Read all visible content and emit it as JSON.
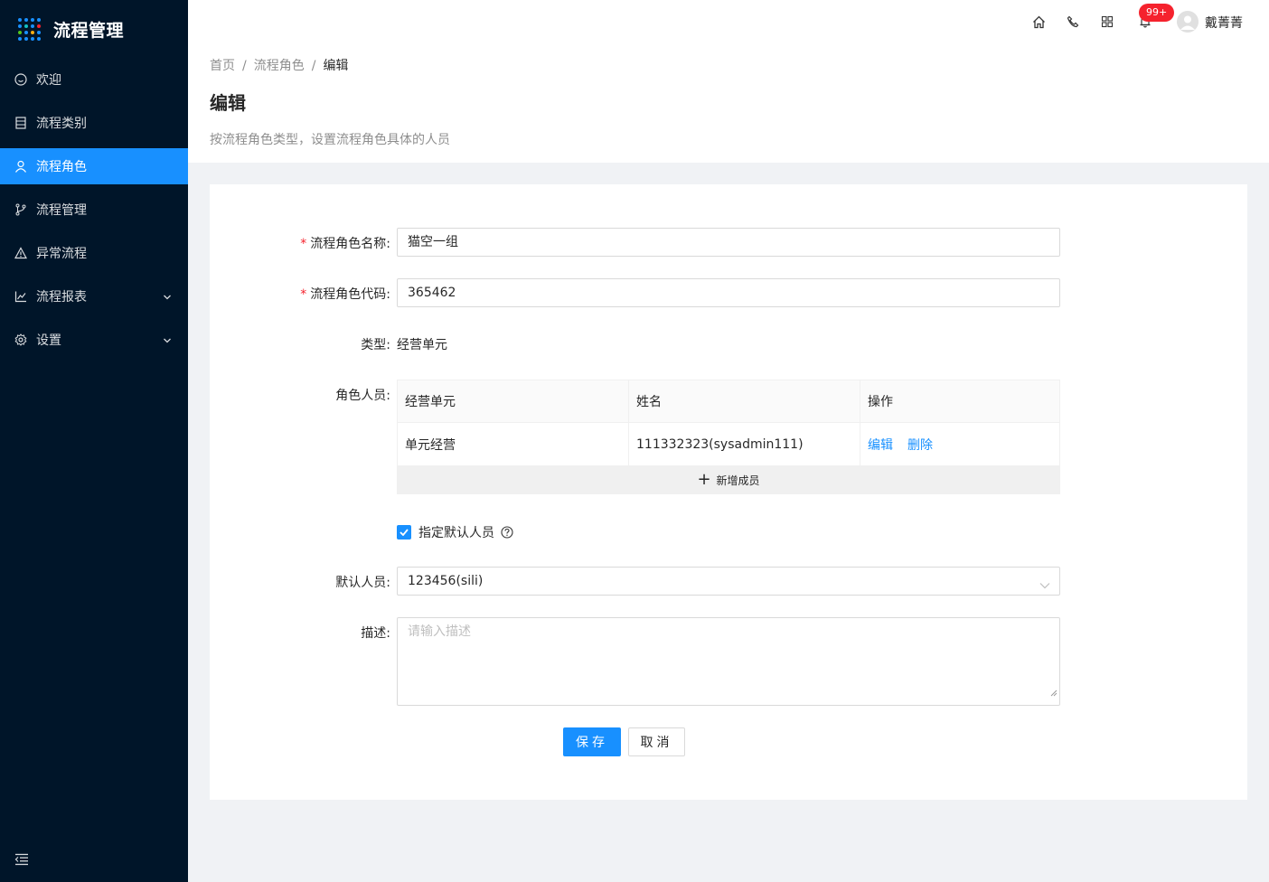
{
  "app": {
    "title": "流程管理"
  },
  "sidebar": {
    "items": [
      {
        "label": "欢迎",
        "icon": "smile-icon",
        "active": false
      },
      {
        "label": "流程类别",
        "icon": "table-icon",
        "active": false
      },
      {
        "label": "流程角色",
        "icon": "user-icon",
        "active": true
      },
      {
        "label": "流程管理",
        "icon": "branch-icon",
        "active": false
      },
      {
        "label": "异常流程",
        "icon": "warning-icon",
        "active": false
      },
      {
        "label": "流程报表",
        "icon": "line-chart-icon",
        "active": false,
        "expandable": true
      },
      {
        "label": "设置",
        "icon": "setting-icon",
        "active": false,
        "expandable": true
      }
    ]
  },
  "header": {
    "notification_count": "99+",
    "username": "戴菁菁"
  },
  "breadcrumb": {
    "home": "首页",
    "parent": "流程角色",
    "current": "编辑",
    "separator": "/"
  },
  "page": {
    "title": "编辑",
    "description": "按流程角色类型，设置流程角色具体的人员"
  },
  "form": {
    "name_label": "流程角色名称:",
    "name_value": "猫空一组",
    "code_label": "流程角色代码:",
    "code_value": "365462",
    "type_label": "类型:",
    "type_value": "经营单元",
    "members_label": "角色人员:",
    "table": {
      "columns": [
        "经营单元",
        "姓名",
        "操作"
      ],
      "rows": [
        {
          "unit": "单元经营",
          "name": "111332323(sysadmin111)",
          "actions": [
            "编辑",
            "删除"
          ]
        }
      ]
    },
    "add_member_label": "新增成员",
    "default_checkbox_label": "指定默认人员",
    "default_checked": true,
    "default_person_label": "默认人员:",
    "default_person_value": "123456(sili)",
    "desc_label": "描述:",
    "desc_placeholder": "请输入描述",
    "save_label": "保存",
    "cancel_label": "取消"
  },
  "colors": {
    "primary": "#1890ff",
    "sidebar_bg": "#001529",
    "badge": "#f5222d"
  }
}
